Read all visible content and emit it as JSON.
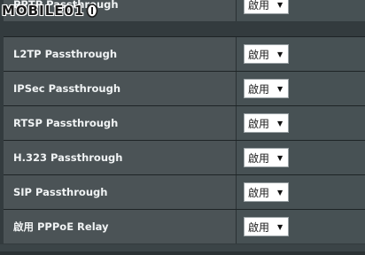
{
  "watermark": {
    "text": "MOBILE01"
  },
  "settings": {
    "rows": [
      {
        "label": "PPTP Passthrough",
        "value": "啟用"
      },
      {
        "label": "L2TP Passthrough",
        "value": "啟用"
      },
      {
        "label": "IPSec Passthrough",
        "value": "啟用"
      },
      {
        "label": "RTSP Passthrough",
        "value": "啟用"
      },
      {
        "label": "H.323 Passthrough",
        "value": "啟用"
      },
      {
        "label": "SIP Passthrough",
        "value": "啟用"
      },
      {
        "label": "啟用 PPPoE Relay",
        "value": "啟用"
      }
    ]
  },
  "icons": {
    "dropdown": "triangle-down-icon",
    "badge": "mobile01-logo-icon"
  },
  "colors": {
    "background": "#333b3e",
    "label_cell": "#4b5356",
    "value_cell": "#475154",
    "text": "#f0f3f4"
  }
}
